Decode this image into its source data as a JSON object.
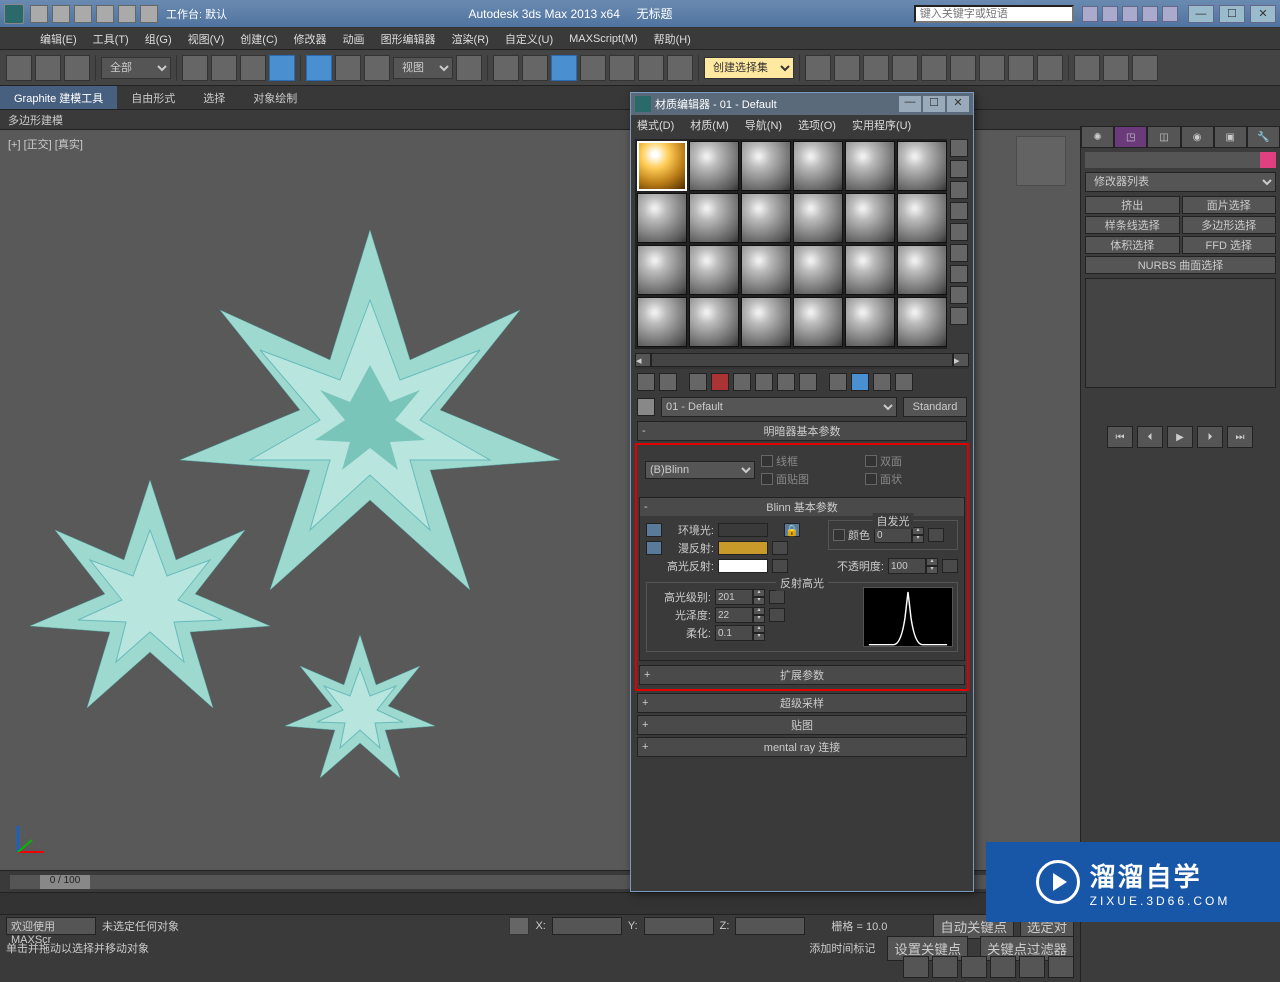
{
  "title": {
    "app": "Autodesk 3ds Max  2013 x64",
    "doc": "无标题",
    "workspace": "工作台: 默认",
    "search_placeholder": "键入关键字或短语"
  },
  "menu": [
    "编辑(E)",
    "工具(T)",
    "组(G)",
    "视图(V)",
    "创建(C)",
    "修改器",
    "动画",
    "图形编辑器",
    "渲染(R)",
    "自定义(U)",
    "MAXScript(M)",
    "帮助(H)"
  ],
  "maintb": {
    "selfilter": "全部",
    "viewmode": "视图",
    "createset": "创建选择集"
  },
  "ribbon": {
    "tabs": [
      "Graphite 建模工具",
      "自由形式",
      "选择",
      "对象绘制"
    ],
    "polyrow": "多边形建模"
  },
  "viewport": {
    "label": "[+] [正交] [真实]"
  },
  "cmdpanel": {
    "modlist": "修改器列表",
    "buttons": [
      "挤出",
      "面片选择",
      "样条线选择",
      "多边形选择",
      "体积选择",
      "FFD 选择"
    ],
    "nurbs": "NURBS 曲面选择"
  },
  "timeline": {
    "frame": "0 / 100"
  },
  "status": {
    "noselection": "未选定任何对象",
    "hint": "单击并拖动以选择并移动对象",
    "x": "X:",
    "y": "Y:",
    "z": "Z:",
    "grid": "栅格 = 10.0",
    "autokey": "自动关键点",
    "setkey": "设置关键点",
    "addtime": "添加时间标记",
    "keyfilter": "关键点过滤器",
    "selectlock": "选定对",
    "welcome": "欢迎使用  MAXScr"
  },
  "mateditor": {
    "title": "材质编辑器 - 01 - Default",
    "menu": [
      "模式(D)",
      "材质(M)",
      "导航(N)",
      "选项(O)",
      "实用程序(U)"
    ],
    "matname": "01 - Default",
    "mattype": "Standard",
    "rollouts": {
      "shader_basic": "明暗器基本参数",
      "blinn_basic": "Blinn 基本参数",
      "extended": "扩展参数",
      "supersample": "超级采样",
      "maps": "贴图",
      "mentalray": "mental ray 连接"
    },
    "shader": {
      "type": "(B)Blinn",
      "wire": "线框",
      "twosided": "双面",
      "facemap": "面贴图",
      "faceted": "面状"
    },
    "blinn": {
      "selfillum_grp": "自发光",
      "color_chk": "颜色",
      "color_val": "0",
      "ambient": "环境光:",
      "diffuse": "漫反射:",
      "specular": "高光反射:",
      "opacity": "不透明度:",
      "opacity_val": "100",
      "spec_grp": "反射高光",
      "spec_level": "高光级别:",
      "spec_level_val": "201",
      "gloss": "光泽度:",
      "gloss_val": "22",
      "soften": "柔化:",
      "soften_val": "0.1",
      "ambient_color": "#c89a2a",
      "diffuse_color": "#c89a2a",
      "specular_color": "#ffffff"
    }
  },
  "watermark": {
    "main": "溜溜自学",
    "sub": "ZIXUE.3D66.COM"
  }
}
